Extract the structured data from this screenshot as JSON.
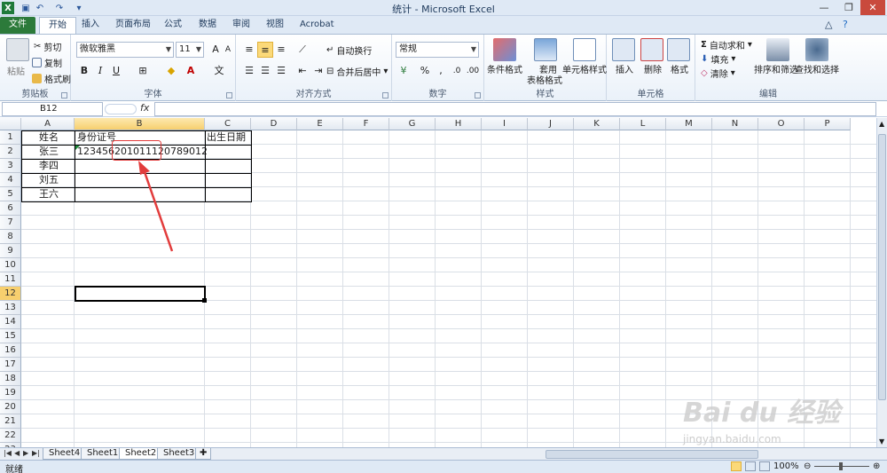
{
  "window": {
    "title": "统计 - Microsoft Excel"
  },
  "tabs": [
    {
      "label": "文件"
    },
    {
      "label": "开始"
    },
    {
      "label": "插入"
    },
    {
      "label": "页面布局"
    },
    {
      "label": "公式"
    },
    {
      "label": "数据"
    },
    {
      "label": "审阅"
    },
    {
      "label": "视图"
    },
    {
      "label": "Acrobat"
    }
  ],
  "ribbon": {
    "clipboard": {
      "label": "剪贴板",
      "paste": "粘贴",
      "cut": "剪切",
      "copy": "复制",
      "format_painter": "格式刷"
    },
    "font": {
      "label": "字体",
      "name": "微软雅黑",
      "size": "11",
      "bold": "B",
      "italic": "I",
      "underline": "U"
    },
    "alignment": {
      "label": "对齐方式",
      "wrap": "自动换行",
      "merge": "合并后居中"
    },
    "number": {
      "label": "数字",
      "format": "常规",
      "percent": "%"
    },
    "styles": {
      "label": "样式",
      "conditional": "条件格式",
      "table1": "套用",
      "table2": "表格格式",
      "cell_styles": "单元格样式"
    },
    "cells": {
      "label": "单元格",
      "insert": "插入",
      "delete": "删除",
      "format": "格式"
    },
    "editing": {
      "label": "编辑",
      "autosum": "自动求和",
      "fill": "填充",
      "clear": "清除",
      "sort": "排序和筛选",
      "find": "查找和选择"
    }
  },
  "formula_bar": {
    "name_box": "B12",
    "fx": "fx",
    "value": ""
  },
  "columns": [
    "A",
    "B",
    "C",
    "D",
    "E",
    "F",
    "G",
    "H",
    "I",
    "J",
    "K",
    "L",
    "M",
    "N",
    "O",
    "P"
  ],
  "rows": [
    "1",
    "2",
    "3",
    "4",
    "5",
    "6",
    "7",
    "8",
    "9",
    "10",
    "11",
    "12",
    "13",
    "14",
    "15",
    "16",
    "17",
    "18",
    "19",
    "20",
    "21",
    "22",
    "23"
  ],
  "cells": {
    "A1": "姓名",
    "B1": "身份证号",
    "C1": "出生日期",
    "A2": "张三",
    "B2": "123456201011120789012",
    "A3": "李四",
    "A4": "刘五",
    "A5": "王六"
  },
  "sheets": [
    {
      "label": "Sheet4"
    },
    {
      "label": "Sheet1"
    },
    {
      "label": "Sheet2"
    },
    {
      "label": "Sheet3"
    }
  ],
  "status": {
    "ready": "就绪",
    "zoom": "100%"
  },
  "watermark": {
    "brand": "Bai du 经验",
    "url": "jingyan.baidu.com"
  }
}
